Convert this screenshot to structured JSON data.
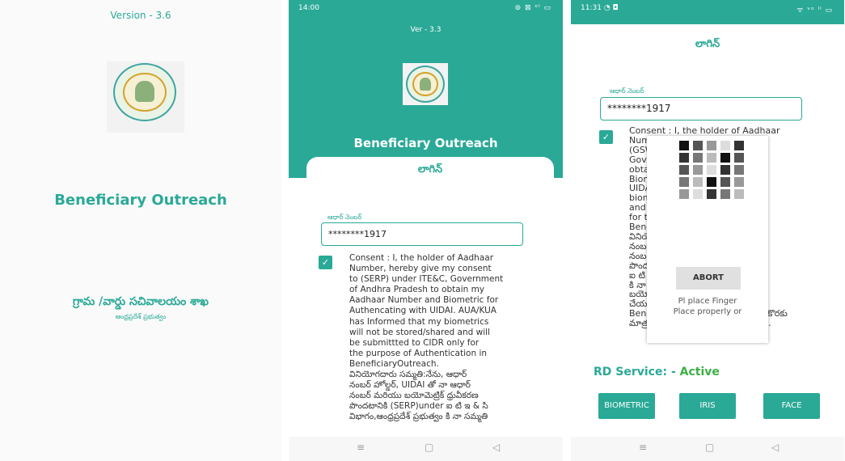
{
  "splash": {
    "version": "Version - 3.6",
    "app_title": "Beneficiary Outreach",
    "department": "గ్రామ /వార్డు సచివాలయం శాఖ",
    "government": "ఆంధ్రప్రదేశ్ ప్రభుత్వం"
  },
  "login_screen": {
    "status_time": "14:00",
    "status_icons": "⊚ ⊠ ᵒˡ ▭",
    "version": "Ver - 3.3",
    "app_title": "Beneficiary Outreach",
    "login_title": "లాగిన్",
    "aadhaar_label": "ఆధార్ నెంబర్",
    "aadhaar_value": "********1917",
    "consent_checked": true,
    "consent_text": "Consent : I, the holder of Aadhaar\nNumber, hereby give my consent\nto (SERP) under ITE&C, Government\nof Andhra Pradesh to obtain my\nAadhaar Number and Biometric for\nAuthencating with UIDAI. AUA/KUA\nhas Informed that my biometrics\nwill not be stored/shared and will\nbe submittted to CIDR only for\nthe purpose of Authentication in\nBeneficiaryOutreach.\nవినియోగదారు సమ్మతి:నేను, ఆధార్\nనంబర్ హోల్డర్, UIDAI తో నా ఆధార్\nనంబర్ మరియు బయోమెట్రిక్ ధ్రువీకరణ\nపొందటానికి (SERP)under ఐ టి ఇ & సి\nవిభాగం,ఆంధ్రప్రదేశ్ ప్రభుత్వం కి నా సమ్మతి"
  },
  "capture_screen": {
    "status_time": "11:31",
    "status_icons": "◔ ◘",
    "status_icons_right": "ᯤ ᵛᵒ ˡˡ ▭",
    "login_title": "లాగిన్",
    "aadhaar_label": "ఆధార్ నెంబర్",
    "aadhaar_value": "********1917",
    "consent_checked": true,
    "consent_text": "Consent : I, the holder of Aadhaar\nNumb                       onsent to\n(GSW:                      ITE&C,\nGover                       desh to\nobtai                       r and\nBiom                       g with\nUIDAI                      hed that my\nbiom                        ed/shared\nand w                      CIDR only\nfor th                       ication in\nBenef\nవినియో                      ఆధార్\nనంబర్                        ధార్\nనంబర్                        వీకరణ\nపొందట                      ent)under\nఐ టి ఇ                       ప్రభుత్వం\nకి నా స                       KUA నా\nబయోవె                      ాగస్వామ్యం\nచేయబ                        రియు\nBeneficiaryOutreach ప్ర ధ్రువీకరణ కొరకు\nమాత్రమే CIDR కు సమర్పించబడుతుంది.",
    "rd_service_label": "RD Service: -",
    "rd_service_status": "Active",
    "buttons": {
      "biometric": "BIOMETRIC",
      "iris": "IRIS",
      "face": "FACE"
    },
    "overlay": {
      "abort": "ABORT",
      "message": "Pl place Finger\nPlace properly or"
    }
  },
  "nav_icons": [
    "≡",
    "▢",
    "◁"
  ]
}
